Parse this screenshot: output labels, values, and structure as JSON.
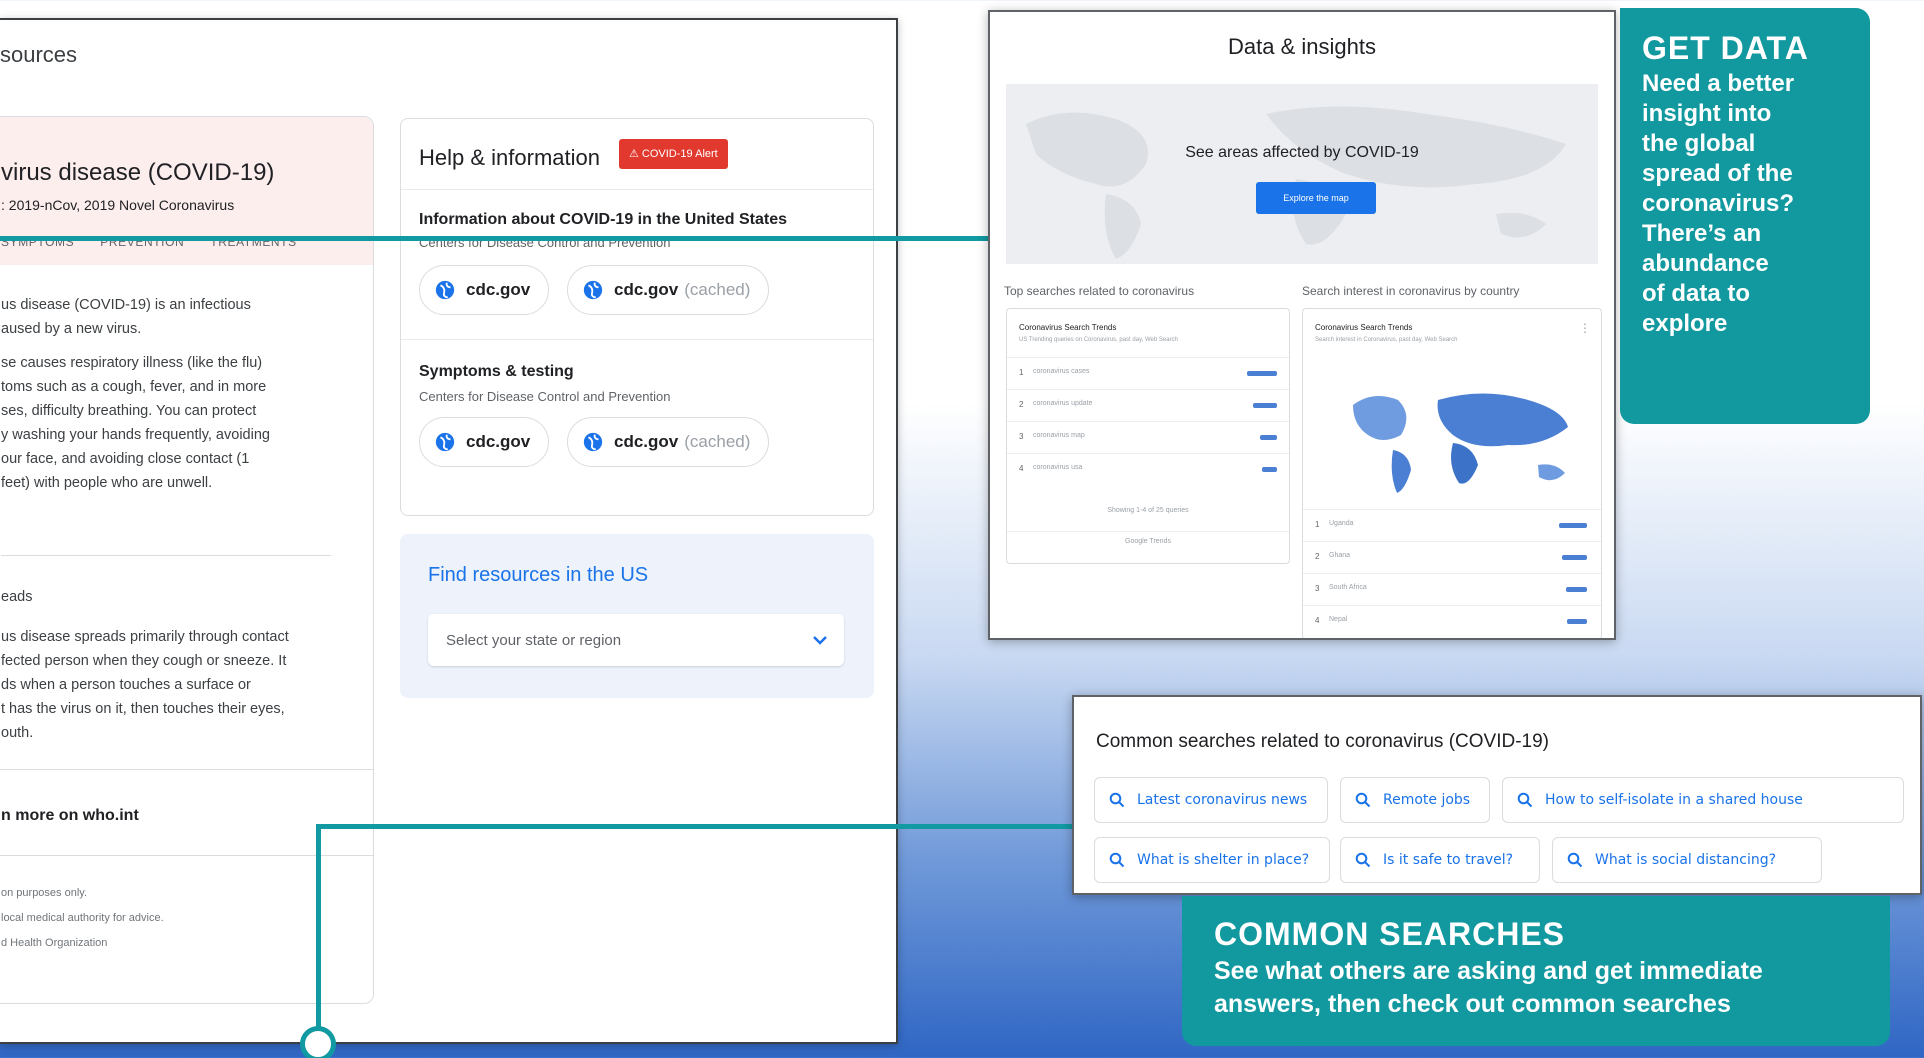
{
  "main": {
    "resources_title": "sources",
    "overview": {
      "title": "virus disease (COVID-19)",
      "subtitle": ": 2019-nCov, 2019 Novel Coronavirus",
      "tabs": [
        "SYMPTOMS",
        "PREVENTION",
        "TREATMENTS"
      ],
      "para1": [
        "us disease (COVID-19) is an infectious",
        "aused by a new virus."
      ],
      "para2": [
        "se causes respiratory illness (like the flu)",
        "toms such as a cough, fever, and in more",
        "ses, difficulty breathing. You can protect",
        "y washing your hands frequently, avoiding",
        "our face, and avoiding close contact (1",
        "feet) with people who are unwell."
      ],
      "spreads_label": "eads",
      "para3": [
        "us disease spreads primarily through contact",
        "fected person when they cough or sneeze. It",
        "ds when a person touches a surface or",
        "t has the virus on it, then touches their eyes,",
        "outh."
      ],
      "learn_more": "n more on who.int",
      "footnotes": [
        "on purposes only.",
        "local medical authority for advice.",
        "d Health Organization"
      ]
    },
    "help": {
      "title": "Help & information",
      "alert": "⚠ COVID-19 Alert",
      "section1_title": "Information about COVID-19 in the United States",
      "section1_sub": "Centers for Disease Control and Prevention",
      "section2_title": "Symptoms & testing",
      "section2_sub": "Centers for Disease Control and Prevention",
      "link": "cdc.gov",
      "cached": "(cached)"
    },
    "find": {
      "title": "Find resources in the US",
      "select_placeholder": "Select your state or region"
    }
  },
  "data_insights": {
    "title": "Data & insights",
    "map_label": "See areas affected by COVID-19",
    "map_button": "Explore the map",
    "top_searches_label": "Top searches related to coronavirus",
    "interest_label": "Search interest in coronavirus by country",
    "trends_card_title": "Coronavirus Search Trends",
    "trends_card_sub": "US Trending queries on Coronavirus, past day, Web Search",
    "trends_rows": [
      {
        "n": "1",
        "t": "coronavirus cases",
        "fill": 1.0
      },
      {
        "n": "2",
        "t": "coronavirus update",
        "fill": 0.8
      },
      {
        "n": "3",
        "t": "coronavirus map",
        "fill": 0.55
      },
      {
        "n": "4",
        "t": "coronavirus usa",
        "fill": 0.5
      }
    ],
    "trends_pager": "Showing 1-4 of 25 queries",
    "trends_source": "Google Trends",
    "country_card_title": "Coronavirus Search Trends",
    "country_card_sub": "Search interest in Coronavirus, past day, Web Search",
    "country_rows": [
      {
        "n": "1",
        "t": "Uganda",
        "fill": 1.0
      },
      {
        "n": "2",
        "t": "Ghana",
        "fill": 0.9
      },
      {
        "n": "3",
        "t": "South Africa",
        "fill": 0.75
      },
      {
        "n": "4",
        "t": "Nepal",
        "fill": 0.7
      }
    ]
  },
  "callouts": {
    "data_heading": "GET DATA",
    "data_body": [
      "Need a better",
      "insight into",
      "the global",
      "spread of the",
      "coronavirus?",
      "There’s an",
      "abundance",
      "of data to",
      "explore"
    ],
    "common_heading": "COMMON SEARCHES",
    "common_body": [
      "See what others are asking and get immediate",
      "answers, then check out common searches"
    ]
  },
  "common": {
    "title": "Common searches related to coronavirus (COVID-19)",
    "queries": [
      "Latest coronavirus news",
      "Remote jobs",
      "How to self-isolate in a shared house",
      "What is shelter in place?",
      "Is it safe to travel?",
      "What is social distancing?"
    ]
  },
  "colors": {
    "teal": "#12999f",
    "link_blue": "#1a73e8",
    "alert_red": "#e2392f"
  }
}
